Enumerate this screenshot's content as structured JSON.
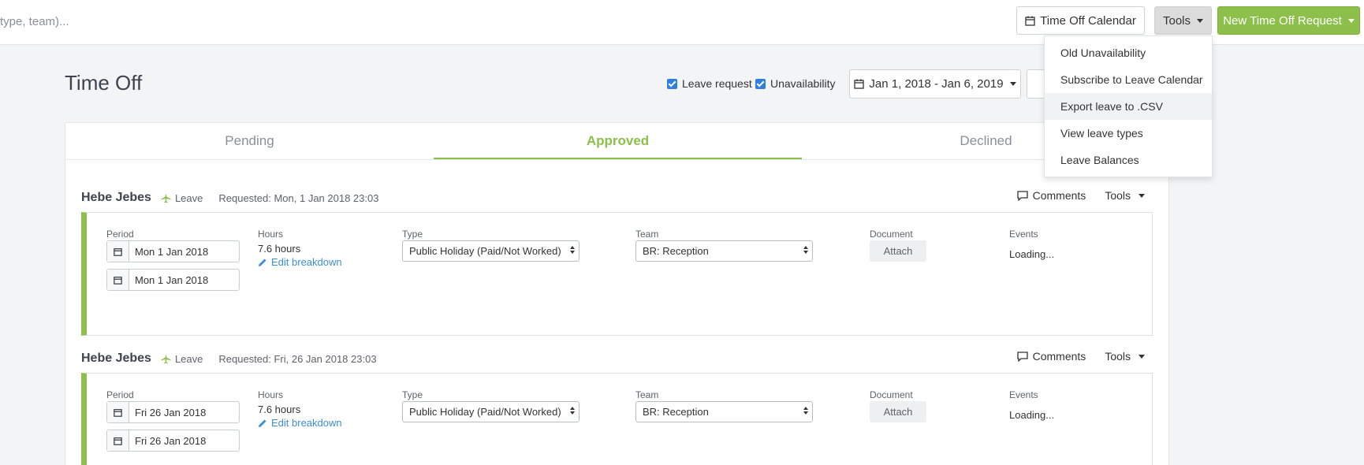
{
  "topbar": {
    "search_hint": "type, team)...",
    "calendar_label": "Time Off Calendar",
    "tools_label": "Tools",
    "new_request_label": "New Time Off Request"
  },
  "tools_menu": {
    "items": [
      {
        "label": "Old Unavailability"
      },
      {
        "label": "Subscribe to Leave Calendar"
      },
      {
        "label": "Export leave to .CSV",
        "highlighted": true
      },
      {
        "label": "View leave types"
      },
      {
        "label": "Leave Balances"
      }
    ]
  },
  "page": {
    "title": "Time Off",
    "filters": {
      "leave_request": {
        "label": "Leave request",
        "checked": true
      },
      "unavailability": {
        "label": "Unavailability",
        "checked": true
      }
    },
    "date_range": "Jan 1, 2018 - Jan 6, 2019"
  },
  "tabs": [
    {
      "label": "Pending"
    },
    {
      "label": "Approved",
      "active": true
    },
    {
      "label": "Declined"
    }
  ],
  "columns": {
    "period": "Period",
    "hours": "Hours",
    "type": "Type",
    "team": "Team",
    "document": "Document",
    "events": "Events"
  },
  "requests": [
    {
      "name": "Hebe Jebes",
      "kind": "Leave",
      "requested": "Requested: Mon, 1 Jan 2018 23:03",
      "comments_label": "Comments",
      "tools_label": "Tools",
      "start": "Mon 1 Jan 2018",
      "end": "Mon 1 Jan 2018",
      "hours": "7.6 hours",
      "edit_label": "Edit breakdown",
      "type": "Public Holiday (Paid/Not Worked)",
      "team": "BR: Reception",
      "attach_label": "Attach",
      "events": "Loading..."
    },
    {
      "name": "Hebe Jebes",
      "kind": "Leave",
      "requested": "Requested: Fri, 26 Jan 2018 23:03",
      "comments_label": "Comments",
      "tools_label": "Tools",
      "start": "Fri 26 Jan 2018",
      "end": "Fri 26 Jan 2018",
      "hours": "7.6 hours",
      "edit_label": "Edit breakdown",
      "type": "Public Holiday (Paid/Not Worked)",
      "team": "BR: Reception",
      "attach_label": "Attach",
      "events": "Loading..."
    }
  ],
  "colors": {
    "accent_green": "#8cc04b",
    "link_blue": "#3a8fd9",
    "checkbox_blue": "#2f7fe0"
  }
}
